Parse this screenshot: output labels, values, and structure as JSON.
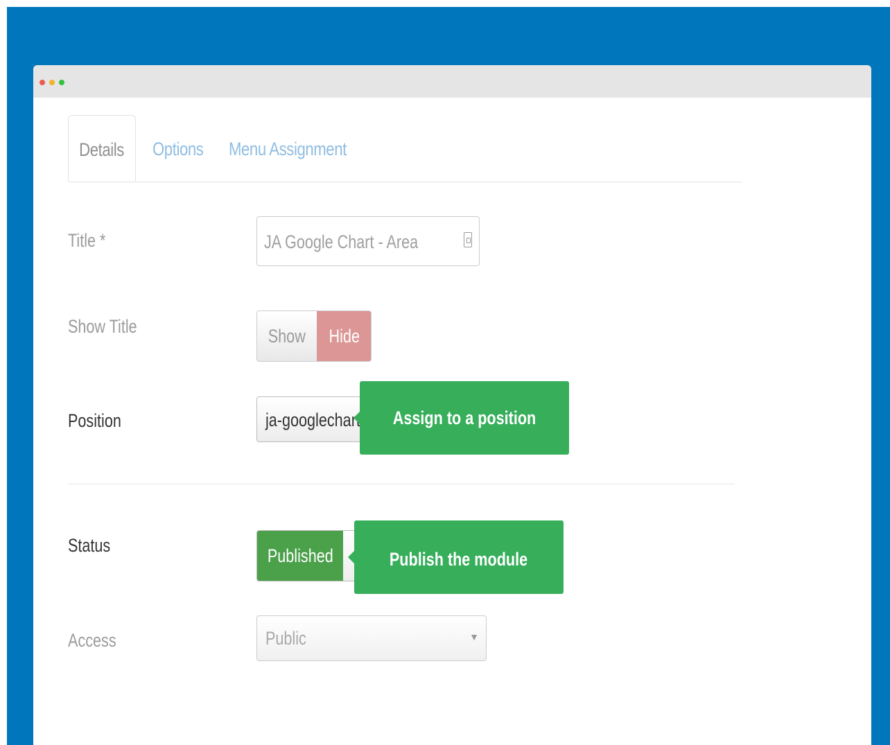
{
  "tabs": {
    "details": "Details",
    "options": "Options",
    "menu_assignment": "Menu Assignment"
  },
  "form": {
    "title_label": "Title *",
    "title_value": "JA Google Chart - Area",
    "show_title_label": "Show Title",
    "show_option": "Show",
    "hide_option": "Hide",
    "position_label": "Position",
    "position_value": "ja-googlechart",
    "status_label": "Status",
    "status_value": "Published",
    "access_label": "Access",
    "access_value": "Public"
  },
  "tooltips": {
    "position": "Assign to a position",
    "status": "Publish the module"
  },
  "colors": {
    "background": "#0077bd",
    "tooltip": "#36ae5a",
    "hide_active": "#db9695",
    "published": "#4ba04a"
  }
}
